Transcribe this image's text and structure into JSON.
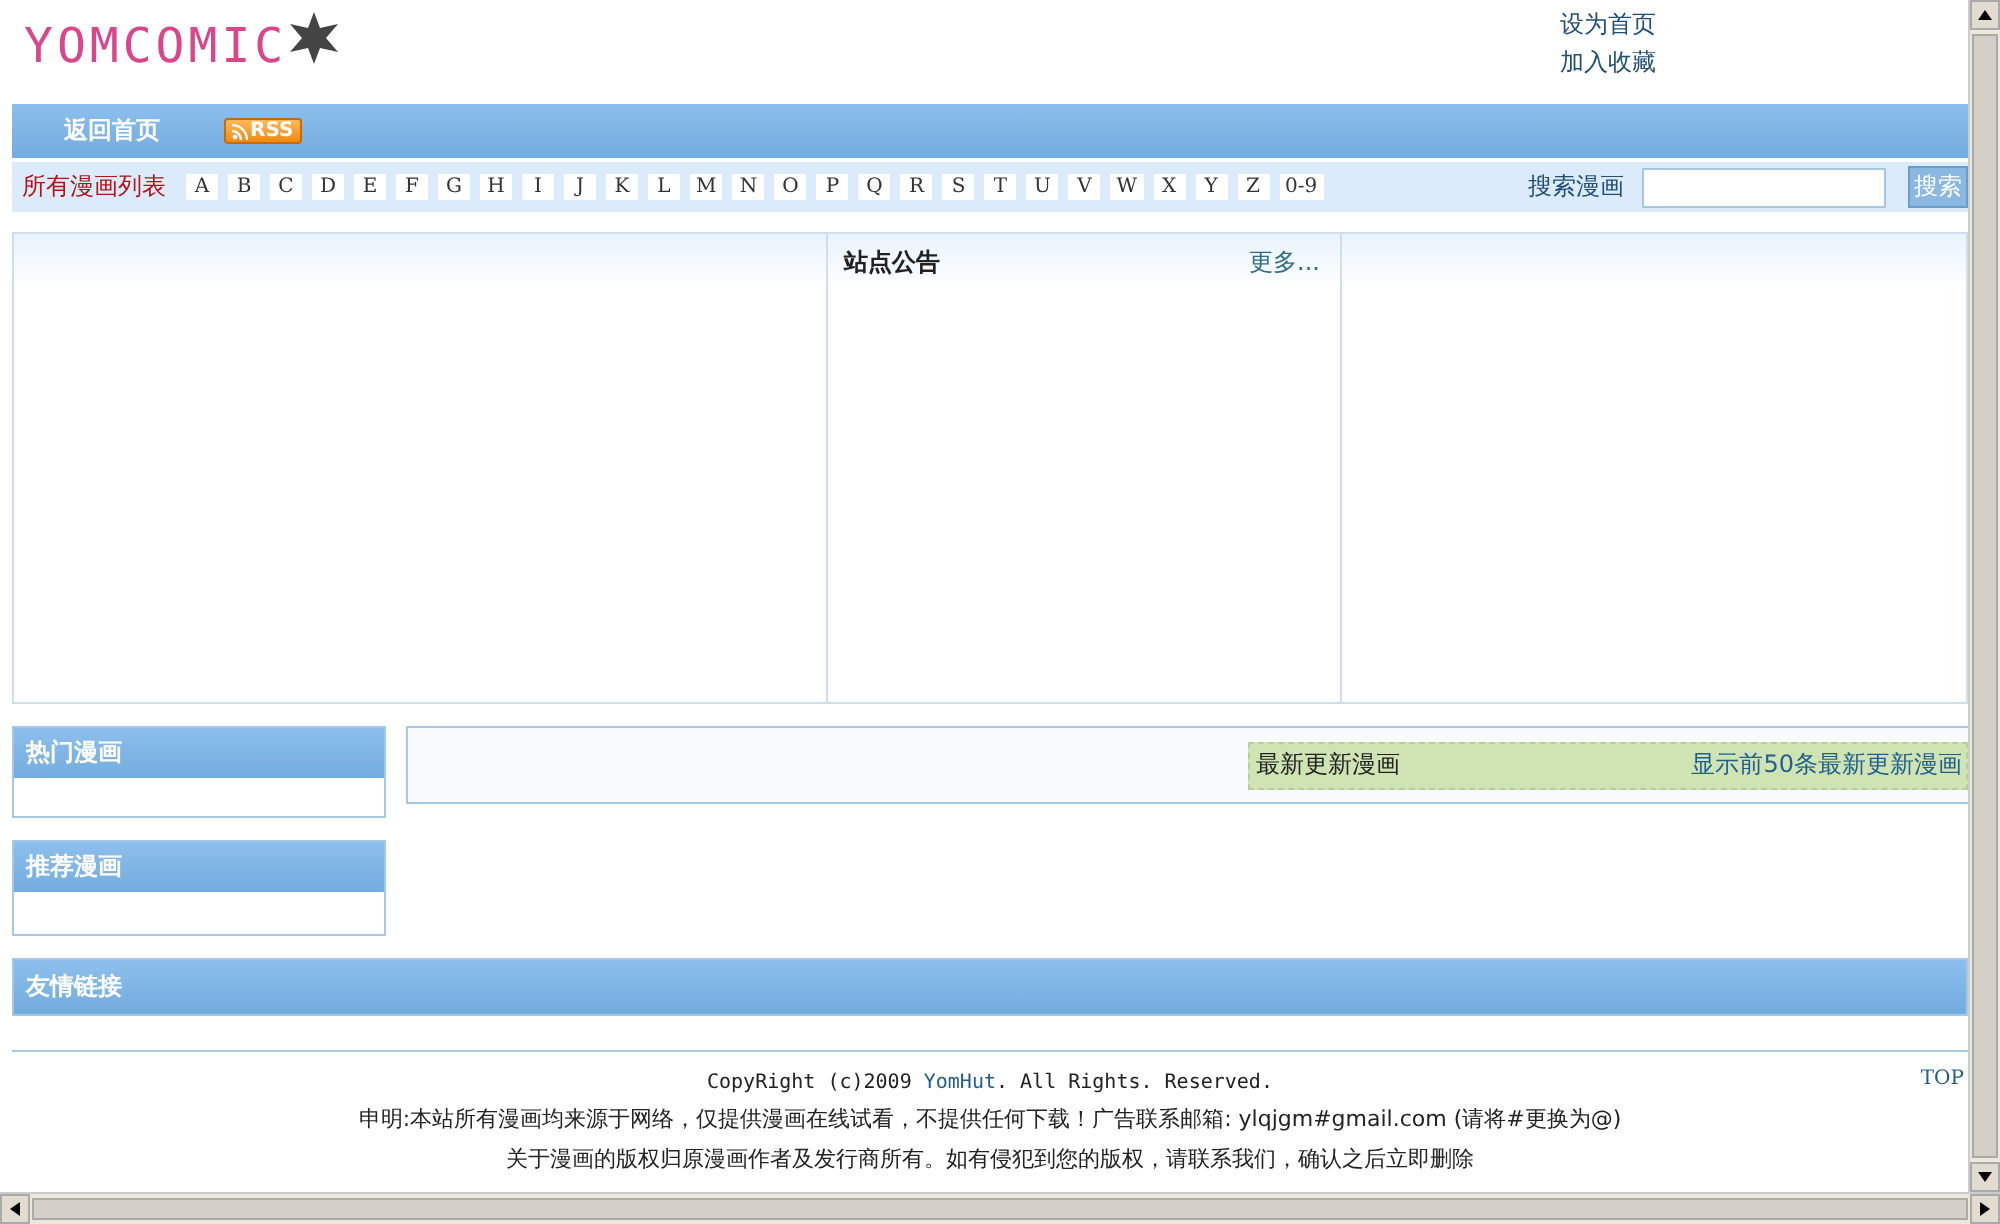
{
  "header": {
    "logo": "YOMCOMIC",
    "links": [
      "设为首页",
      "加入收藏"
    ]
  },
  "nav": {
    "items": [
      {
        "label": "返回首页",
        "kind": "link"
      },
      {
        "label": "RSS",
        "kind": "feed"
      }
    ]
  },
  "letters": {
    "label": "所有漫画列表",
    "items": [
      "A",
      "B",
      "C",
      "D",
      "E",
      "F",
      "G",
      "H",
      "I",
      "J",
      "K",
      "L",
      "M",
      "N",
      "O",
      "P",
      "Q",
      "R",
      "S",
      "T",
      "U",
      "V",
      "W",
      "X",
      "Y",
      "Z",
      "0-9"
    ]
  },
  "search": {
    "label": "搜索漫画",
    "button": "搜索"
  },
  "notice": {
    "title": "站点公告",
    "more": "更多..."
  },
  "sidebar": [
    {
      "title": "热门漫画"
    },
    {
      "title": "推荐漫画"
    }
  ],
  "latest": {
    "title": "最新更新漫画",
    "link": "显示前50条最新更新漫画"
  },
  "friend_links": {
    "title": "友情链接"
  },
  "footer": {
    "copyright_prefix": "CopyRight (c)2009 ",
    "copyright_link": "YomHut",
    "copyright_suffix": ". All Rights. Reserved.",
    "top": "TOP",
    "lines": [
      "申明:本站所有漫画均来源于网络，仅提供漫画在线试看，不提供任何下载！广告联系邮箱: ylqjgm#gmail.com (请将#更换为@)",
      "关于漫画的版权归原漫画作者及发行商所有。如有侵犯到您的版权，请联系我们，确认之后立即删除"
    ]
  }
}
